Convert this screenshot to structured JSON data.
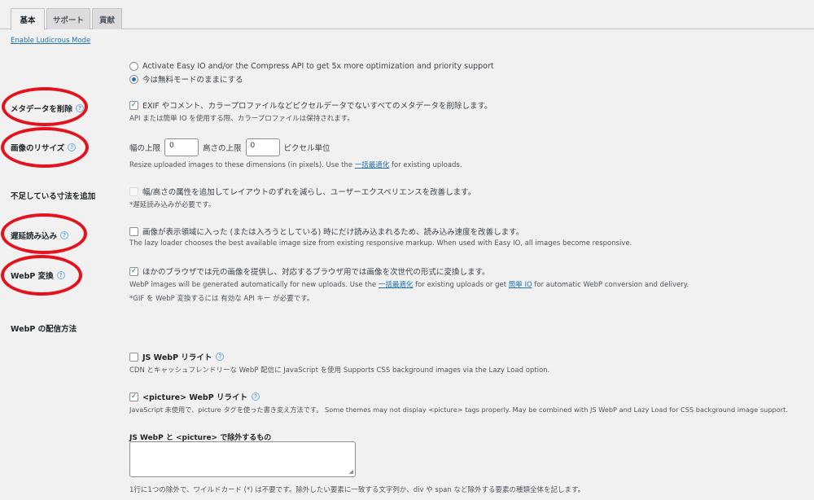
{
  "tabs": [
    {
      "label": "基本",
      "active": true
    },
    {
      "label": "サポート",
      "active": false
    },
    {
      "label": "貢献",
      "active": false
    }
  ],
  "ludicrous_link": "Enable Ludicrous Mode",
  "mode": {
    "option1": "Activate Easy IO and/or the Compress API to get 5x more optimization and priority support",
    "option2": "今は無料モードのままにする",
    "selected": 2
  },
  "metadata": {
    "label": "メタデータを削除",
    "checkbox": "EXIF やコメント、カラープロファイルなどピクセルデータでないすべてのメタデータを削除します。",
    "checked": true,
    "desc": "API または簡単 IO を使用する際、カラープロファイルは保持されます。"
  },
  "resize": {
    "label": "画像のリサイズ",
    "width_label": "幅の上限",
    "width_value": "0",
    "height_label": "高さの上限",
    "height_value": "0",
    "unit": "ピクセル単位",
    "desc_pre": "Resize uploaded images to these dimensions (in pixels). Use the",
    "desc_link": "一括最適化",
    "desc_post": "for existing uploads."
  },
  "dimensions": {
    "label": "不足している寸法を追加",
    "checkbox": "幅/高さの属性を追加してレイアウトのずれを減らし、ユーザーエクスペリエンスを改善します。",
    "note": "*遅延読み込みが必要です。"
  },
  "lazy": {
    "label": "遅延読み込み",
    "checkbox": "画像が表示領域に入った (または入ろうとしている) 時にだけ読み込まれるため、読み込み速度を改善します。",
    "checked": false,
    "desc": "The lazy loader chooses the best available image size from existing responsive markup. When used with Easy IO, all images become responsive."
  },
  "webp": {
    "label": "WebP 変換",
    "checkbox": "ほかのブラウザでは元の画像を提供し、対応するブラウザ用では画像を次世代の形式に変換します。",
    "checked": true,
    "desc_pre": "WebP images will be generated automatically for new uploads. Use the",
    "desc_link1": "一括最適化",
    "desc_mid": "for existing uploads or get",
    "desc_link2": "簡単 IO",
    "desc_post": "for automatic WebP conversion and delivery.",
    "note": "*GIF を WebP 変換するには 有効な API キー が必要です。"
  },
  "delivery": {
    "label": "WebP の配信方法",
    "js_label": "JS WebP リライト",
    "js_checked": false,
    "js_desc": "CDN とキャッシュフレンドリーな WebP 配信に JavaScript を使用 Supports CSS background images via the Lazy Load option.",
    "picture_label": "<picture> WebP リライト",
    "picture_checked": true,
    "picture_desc": "JavaScript 未使用で、picture タグを使った書き変え方法です。 Some themes may not display <picture> tags properly. May be combined with JS WebP and Lazy Load for CSS background image support.",
    "exclude_label": "JS WebP と <picture> で除外するもの",
    "exclude_value": "",
    "exclude_desc": "1行に1つの除外で、ワイルドカード (*) は不要です。除外したい要素に一致する文字列か、div や span など除外する要素の種類全体を記します。"
  },
  "colors": {
    "accent": "#2271b1",
    "annotation": "#e5111d",
    "background": "#f1f1f1"
  }
}
